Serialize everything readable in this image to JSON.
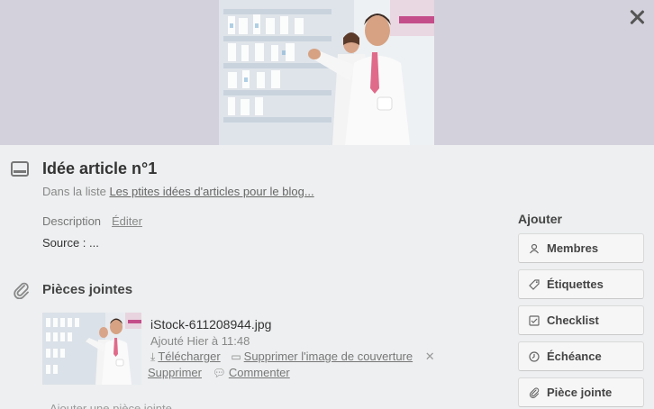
{
  "card": {
    "title": "Idée article n°1",
    "in_list_prefix": "Dans la liste",
    "list_name": "Les ptites idées d'articles pour le blog...",
    "description_label": "Description",
    "edit_label": "Éditer",
    "description_text": "Source : ..."
  },
  "attachments": {
    "heading": "Pièces jointes",
    "items": [
      {
        "filename": "iStock-611208944.jpg",
        "added": "Ajouté Hier à 11:48",
        "download_label": "Télécharger",
        "remove_cover_label": "Supprimer l'image de couverture",
        "delete_label": "Supprimer",
        "comment_label": "Commenter"
      }
    ],
    "add_label": "Ajouter une pièce jointe..."
  },
  "sidebar": {
    "title": "Ajouter",
    "buttons": [
      {
        "label": "Membres",
        "icon": "person-icon"
      },
      {
        "label": "Étiquettes",
        "icon": "tag-icon"
      },
      {
        "label": "Checklist",
        "icon": "checkbox-icon"
      },
      {
        "label": "Échéance",
        "icon": "clock-icon"
      },
      {
        "label": "Pièce jointe",
        "icon": "paperclip-icon"
      }
    ]
  },
  "colors": {
    "cover_bg": "#d3d1dc",
    "panel_bg": "#edeff0"
  }
}
